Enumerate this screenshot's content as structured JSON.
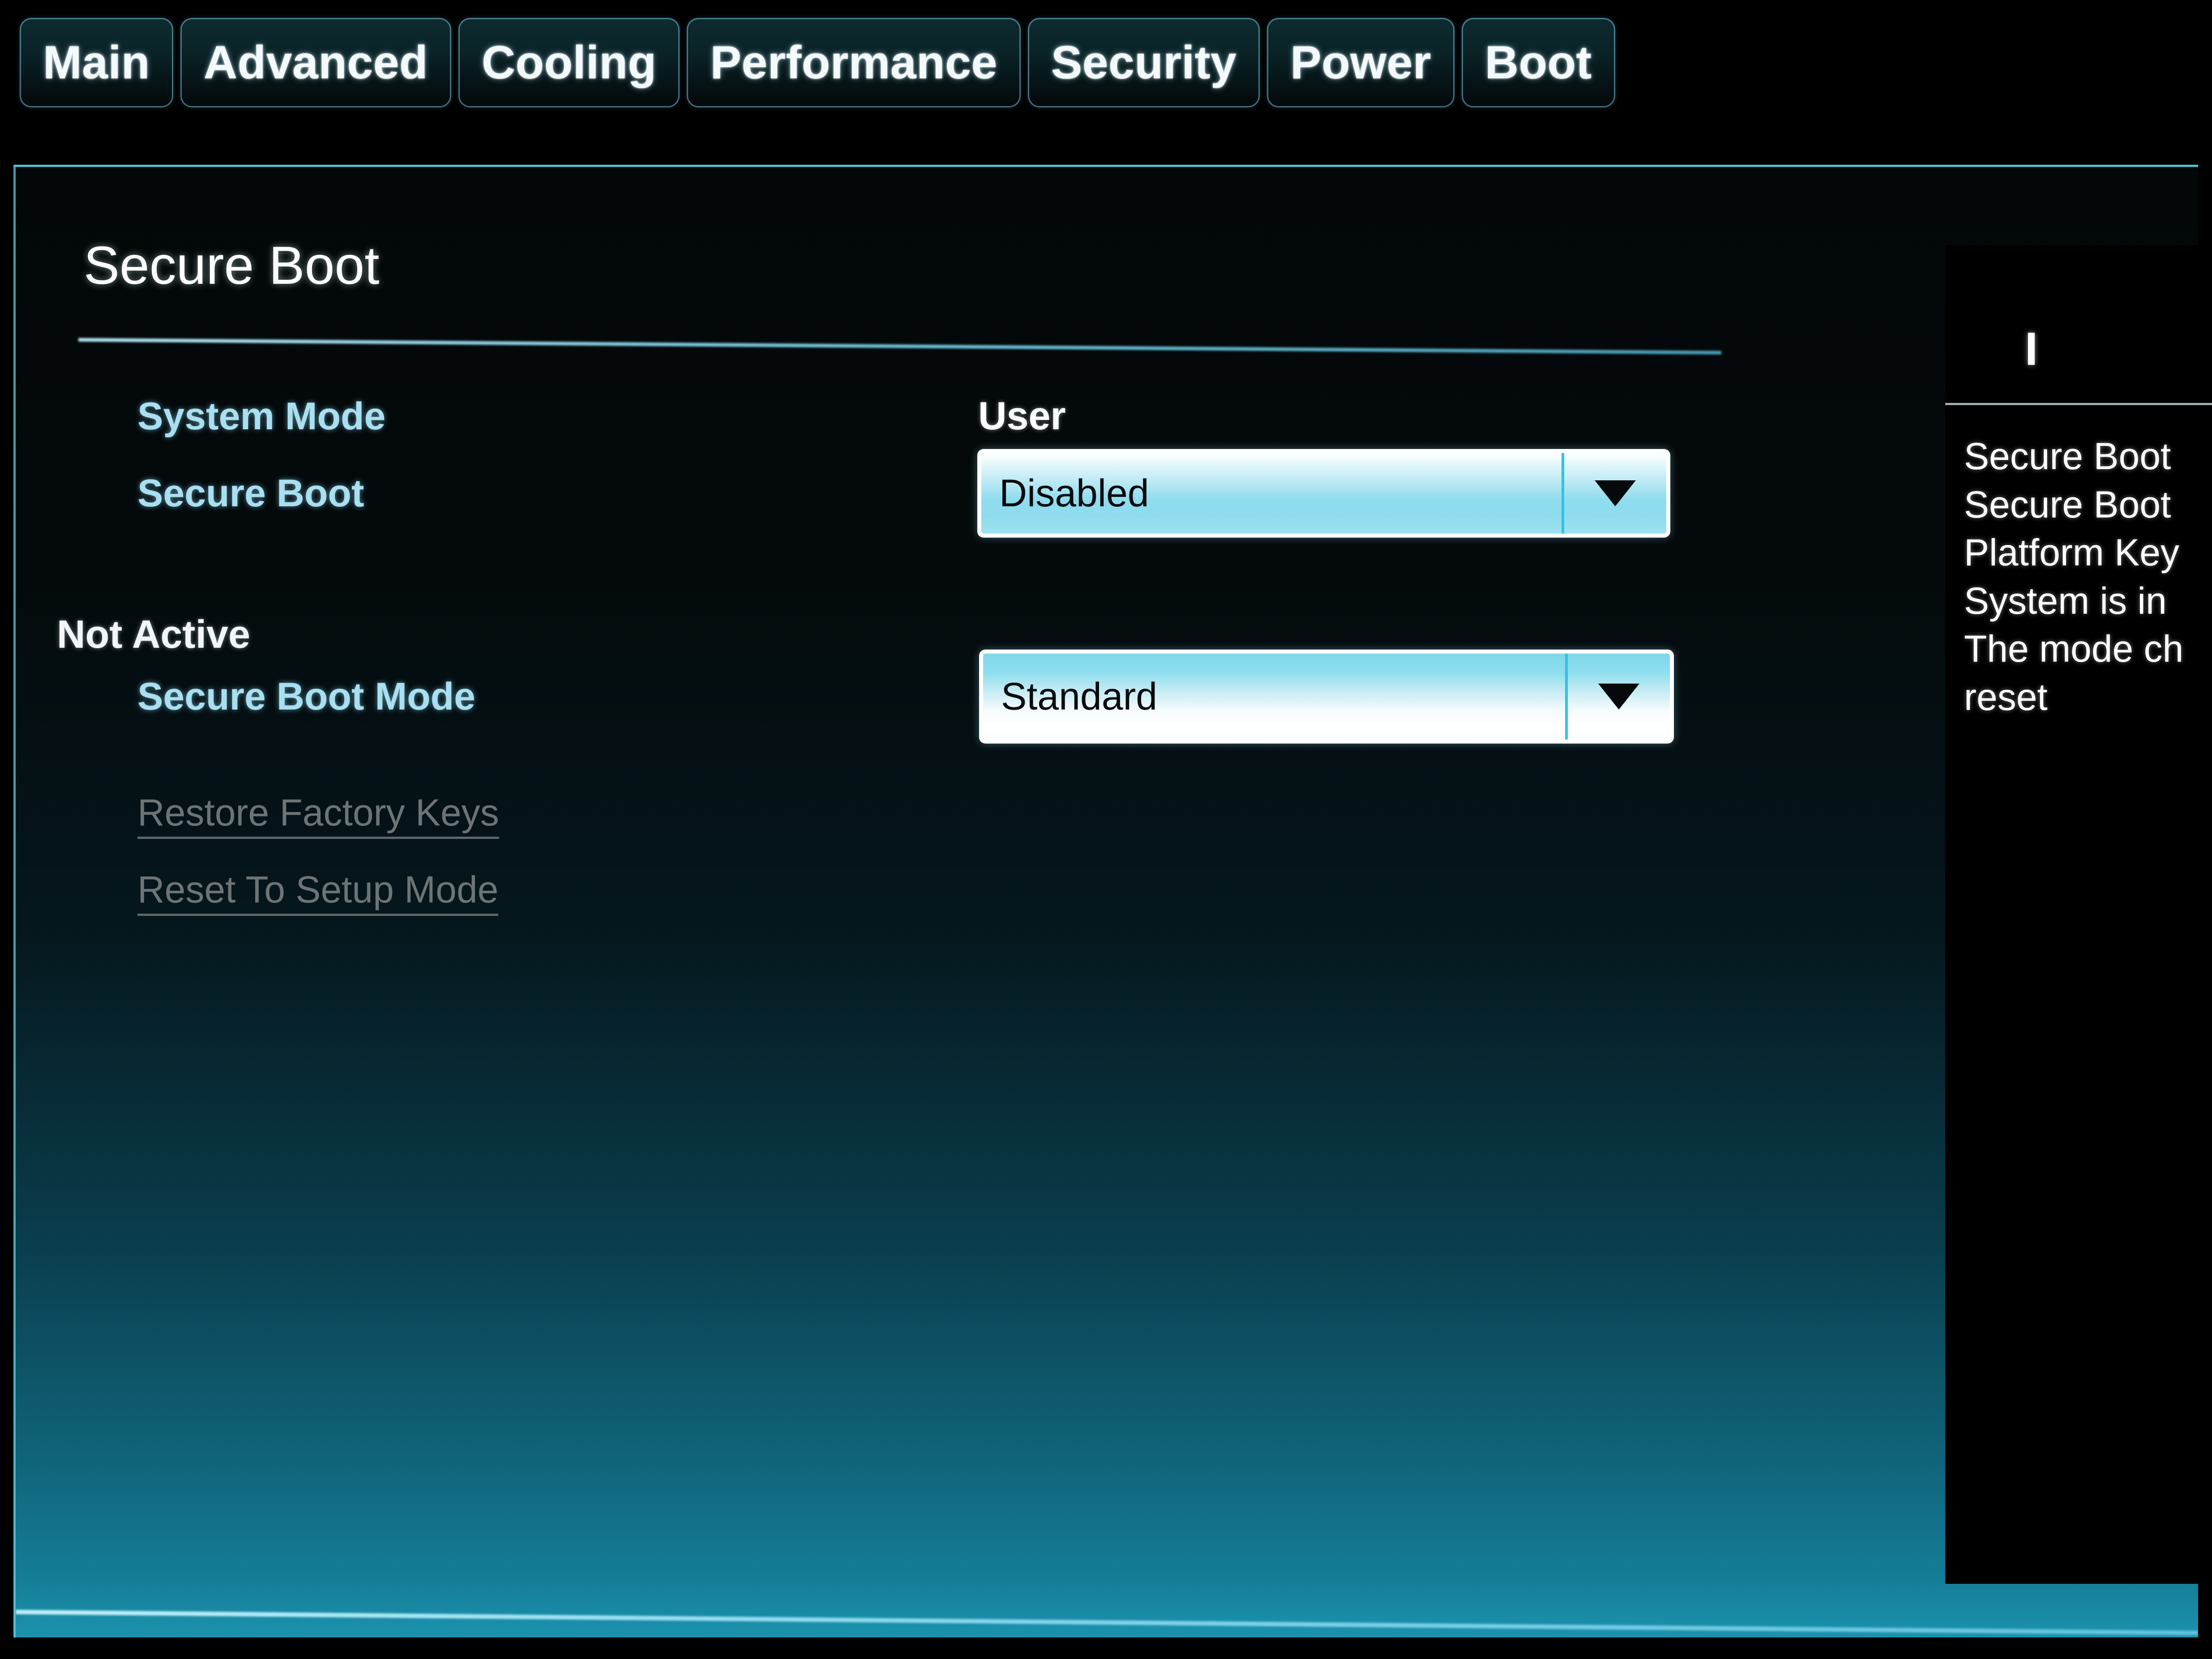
{
  "tabs": [
    {
      "label": "Main"
    },
    {
      "label": "Advanced"
    },
    {
      "label": "Cooling"
    },
    {
      "label": "Performance"
    },
    {
      "label": "Security"
    },
    {
      "label": "Power"
    },
    {
      "label": "Boot"
    }
  ],
  "page": {
    "title": "Secure Boot"
  },
  "settings": {
    "system_mode": {
      "label": "System Mode",
      "value": "User"
    },
    "secure_boot": {
      "label": "Secure Boot",
      "value": "Disabled",
      "arrow_icon": "chevron-down-icon"
    },
    "status_note": "Not Active",
    "secure_boot_mode": {
      "label": "Secure Boot Mode",
      "value": "Standard",
      "arrow_icon": "chevron-down-icon"
    }
  },
  "actions": [
    {
      "label": "Restore Factory Keys",
      "enabled": false
    },
    {
      "label": "Reset To Setup Mode",
      "enabled": false
    }
  ],
  "help": {
    "title": "I",
    "lines": [
      "Secure Boot",
      "Secure Boot",
      "Platform Key",
      "System is in",
      "The mode ch",
      "reset"
    ]
  },
  "colors": {
    "accent_cyan": "#6ecde1",
    "tab_text": "#f4f9fb",
    "label_blue": "#a9dff0",
    "panel_teal": "#1b93ae",
    "disabled_grey": "#6c7476"
  }
}
